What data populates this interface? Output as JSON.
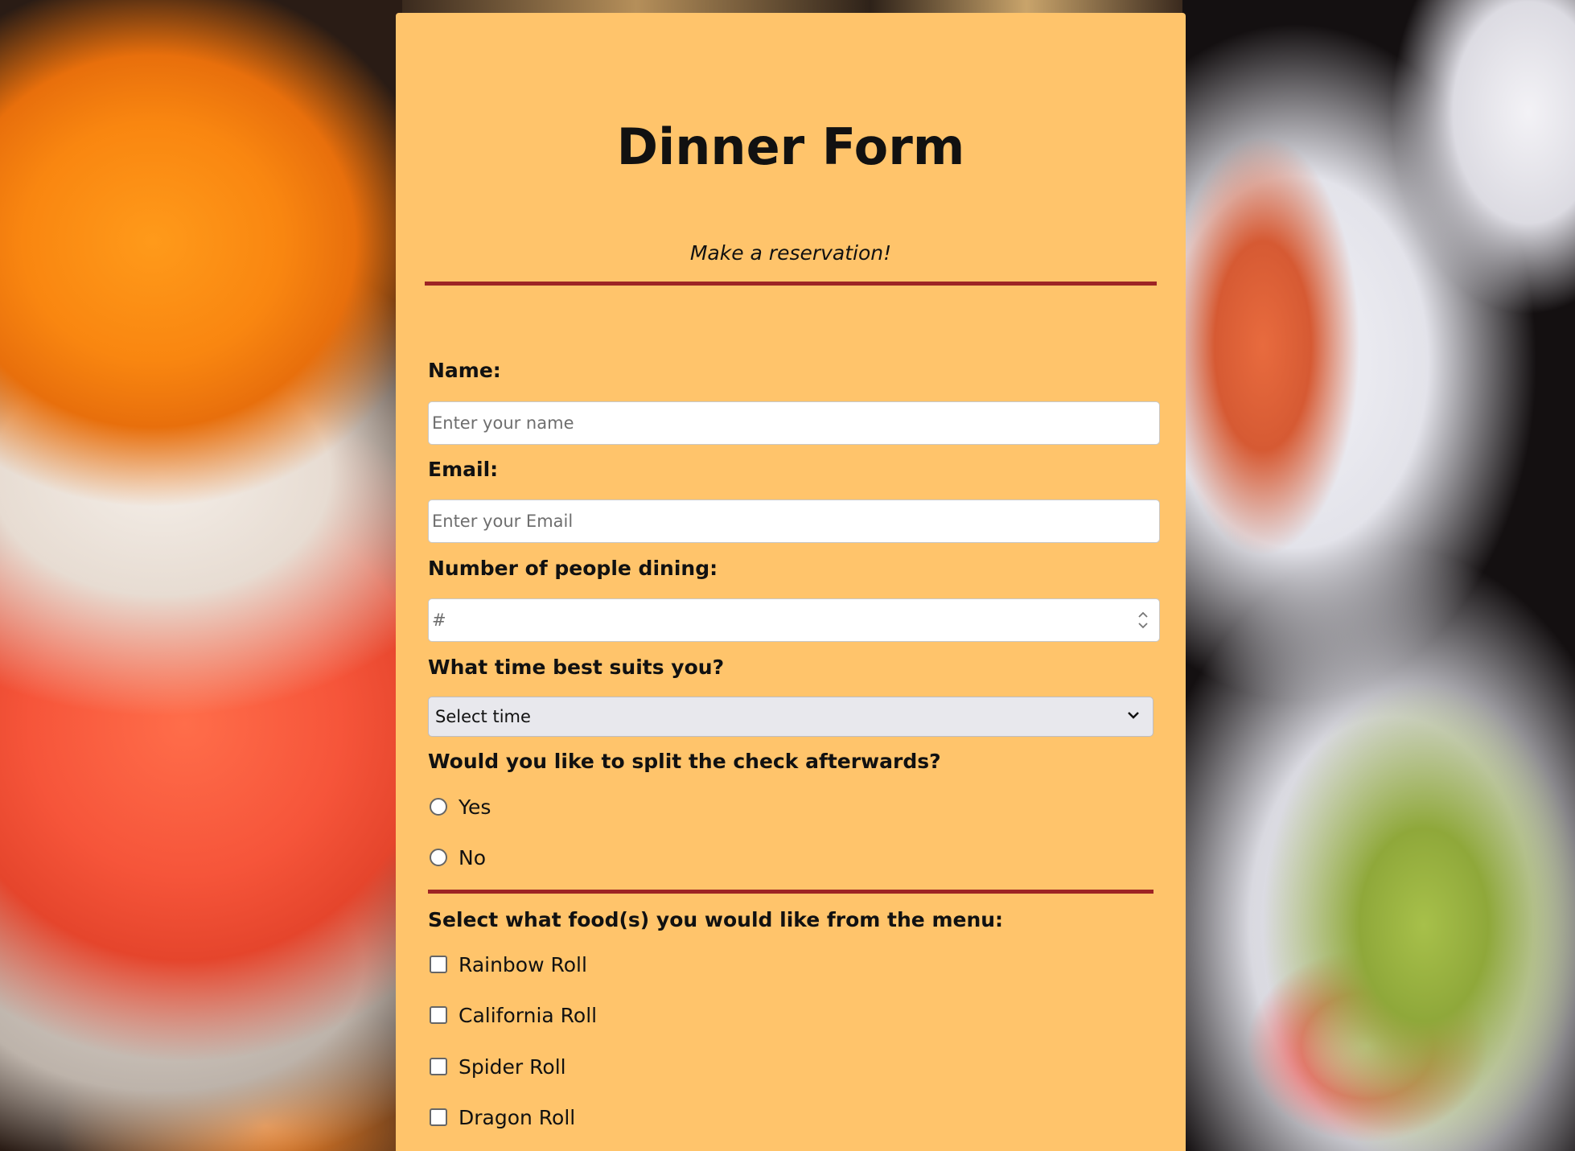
{
  "form": {
    "title": "Dinner Form",
    "subtitle": "Make a reservation!",
    "name": {
      "label": "Name:",
      "placeholder": "Enter your name",
      "value": ""
    },
    "email": {
      "label": "Email:",
      "placeholder": "Enter your Email",
      "value": ""
    },
    "people": {
      "label": "Number of people dining:",
      "placeholder": "#",
      "value": ""
    },
    "time": {
      "label": "What time best suits you?",
      "selected": "Select time"
    },
    "split_check": {
      "label": "Would you like to split the check afterwards?",
      "options": [
        "Yes",
        "No"
      ]
    },
    "menu": {
      "label": "Select what food(s) you would like from the menu:",
      "items": [
        "Rainbow Roll",
        "California Roll",
        "Spider Roll",
        "Dragon Roll"
      ]
    }
  },
  "colors": {
    "panel_background": "#ffc46b",
    "divider": "#9e2424"
  },
  "icons": {
    "select_arrow": "chevron-down-icon",
    "number_spinner": "spinner-arrows-icon"
  }
}
